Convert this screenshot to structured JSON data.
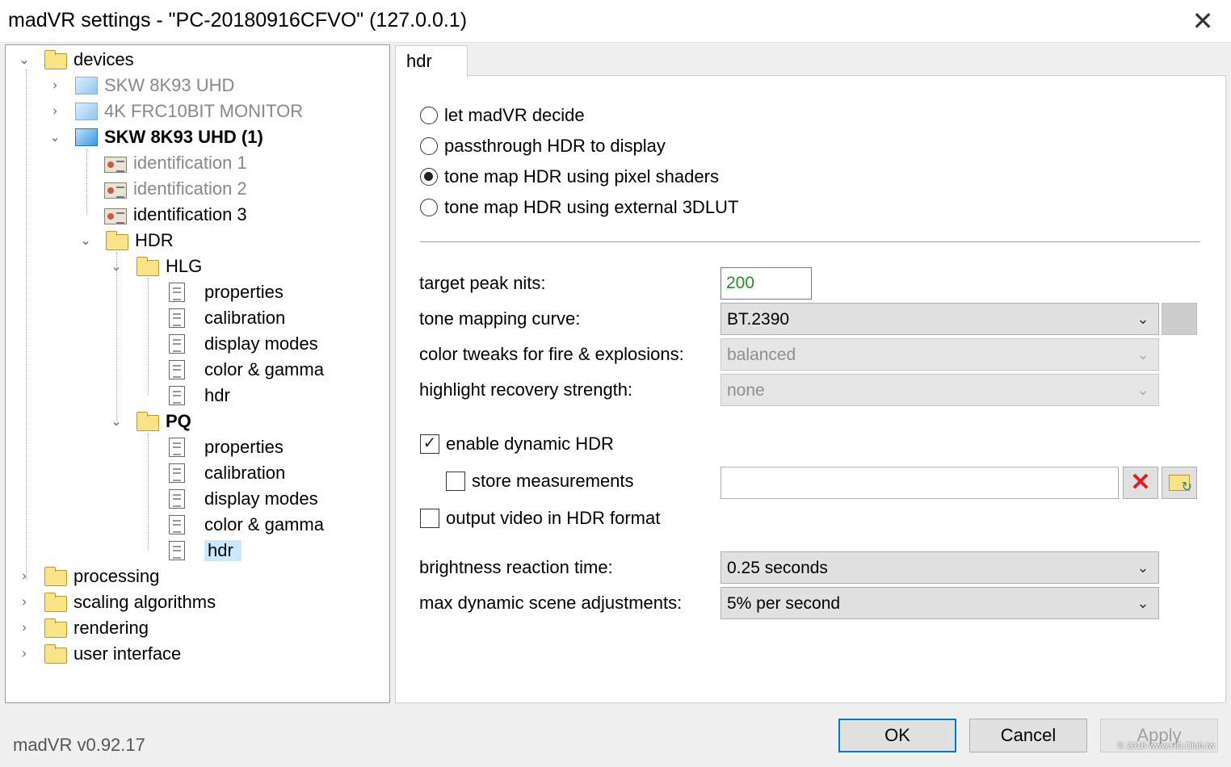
{
  "window": {
    "title": "madVR settings - \"PC-20180916CFVO\" (127.0.0.1)",
    "close_glyph": "✕"
  },
  "tree": {
    "items": [
      {
        "label": "devices",
        "icon": "folder-icon",
        "expander": "⌄"
      },
      {
        "label": "SKW 8K93    UHD",
        "icon": "monitor-icon",
        "expander": "›"
      },
      {
        "label": "4K FRC10BIT MONITOR",
        "icon": "monitor-icon",
        "expander": "›"
      },
      {
        "label": "SKW 8K93    UHD (1)",
        "icon": "monitor-icon",
        "expander": "⌄"
      },
      {
        "label": "identification 1",
        "icon": "identification-icon"
      },
      {
        "label": "identification 2",
        "icon": "identification-icon"
      },
      {
        "label": "identification 3",
        "icon": "identification-icon"
      },
      {
        "label": "HDR",
        "icon": "folder-icon",
        "expander": "⌄"
      },
      {
        "label": "HLG",
        "icon": "folder-icon",
        "expander": "⌄"
      },
      {
        "label": "properties",
        "icon": "page-icon"
      },
      {
        "label": "calibration",
        "icon": "page-icon"
      },
      {
        "label": "display modes",
        "icon": "page-icon"
      },
      {
        "label": "color & gamma",
        "icon": "page-icon"
      },
      {
        "label": "hdr",
        "icon": "page-icon"
      },
      {
        "label": "PQ",
        "icon": "folder-icon",
        "expander": "⌄"
      },
      {
        "label": "properties",
        "icon": "page-icon"
      },
      {
        "label": "calibration",
        "icon": "page-icon"
      },
      {
        "label": "display modes",
        "icon": "page-icon"
      },
      {
        "label": "color & gamma",
        "icon": "page-icon"
      },
      {
        "label": "hdr",
        "icon": "page-icon"
      },
      {
        "label": "processing",
        "icon": "folder-icon",
        "expander": "›"
      },
      {
        "label": "scaling algorithms",
        "icon": "folder-icon",
        "expander": "›"
      },
      {
        "label": "rendering",
        "icon": "folder-icon",
        "expander": "›"
      },
      {
        "label": "user interface",
        "icon": "folder-icon",
        "expander": "›"
      }
    ]
  },
  "version": "madVR v0.92.17",
  "tab": {
    "label": "hdr"
  },
  "hdr_mode": {
    "options": [
      "let madVR decide",
      "passthrough HDR to display",
      "tone map HDR using pixel shaders",
      "tone map HDR using external 3DLUT"
    ],
    "selected_index": 2
  },
  "tone_mapping": {
    "target_peak_nits_label": "target peak nits:",
    "target_peak_nits_value": "200",
    "curve_label": "tone mapping curve:",
    "curve_value": "BT.2390",
    "color_tweaks_label": "color tweaks for fire & explosions:",
    "color_tweaks_value": "balanced",
    "highlight_label": "highlight recovery strength:",
    "highlight_value": "none"
  },
  "dynamic": {
    "enable_label": "enable dynamic HDR",
    "enable_checked": true,
    "store_label": "store measurements",
    "store_checked": false,
    "output_label": "output video in HDR format",
    "output_checked": false,
    "path_value": "",
    "brightness_label": "brightness reaction time:",
    "brightness_value": "0.25 seconds",
    "max_adj_label": "max dynamic scene adjustments:",
    "max_adj_value": "5% per second"
  },
  "icons": {
    "clear_glyph": "✕",
    "dropdown_glyph": "⌄",
    "check_glyph": "✓"
  },
  "buttons": {
    "ok": "OK",
    "cancel": "Cancel",
    "apply": "Apply"
  },
  "watermark": "© 2018 www.HD.Club.tw"
}
